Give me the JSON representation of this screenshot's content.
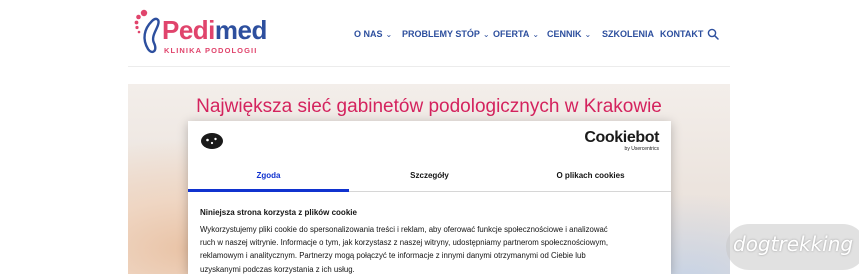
{
  "header": {
    "logo": {
      "word_part1": "Pedi",
      "word_part2": "med",
      "subtitle": "KLINIKA PODOLOGII"
    },
    "nav": [
      {
        "label": "O NAS",
        "dropdown": true
      },
      {
        "label": "PROBLEMY STÓP",
        "dropdown": true
      },
      {
        "label": "OFERTA",
        "dropdown": true
      },
      {
        "label": "CENNIK",
        "dropdown": true
      },
      {
        "label": "SZKOLENIA",
        "dropdown": false
      },
      {
        "label": "KONTAKT",
        "dropdown": false
      }
    ],
    "chevron": "⌄",
    "search_icon": "search-icon"
  },
  "hero": {
    "title": "Największa sieć gabinetów podologicznych w Krakowie"
  },
  "cookie_dialog": {
    "brand": "Cookiebot",
    "brand_sub": "by Usercentrics",
    "tabs": [
      {
        "label": "Zgoda",
        "active": true
      },
      {
        "label": "Szczegóły",
        "active": false
      },
      {
        "label": "O plikach cookies",
        "active": false
      }
    ],
    "heading": "Niniejsza strona korzysta z plików cookie",
    "body_lines": [
      "Wykorzystujemy pliki cookie do spersonalizowania treści i reklam, aby oferować funkcje społecznościowe i analizować",
      "ruch w naszej witrynie. Informacje o tym, jak korzystasz z naszej witryny, udostępniamy partnerom społecznościowym,",
      "reklamowym i analitycznym. Partnerzy mogą połączyć te informacje z innymi danymi otrzymanymi od Ciebie lub",
      "uzyskanymi podczas korzystania z ich usług."
    ]
  },
  "watermark": {
    "text": "dogtrekking"
  },
  "colors": {
    "brand_pink": "#e0446c",
    "brand_blue": "#2d4f9e",
    "hero_title": "#d4235e",
    "tab_active": "#1032cf"
  }
}
